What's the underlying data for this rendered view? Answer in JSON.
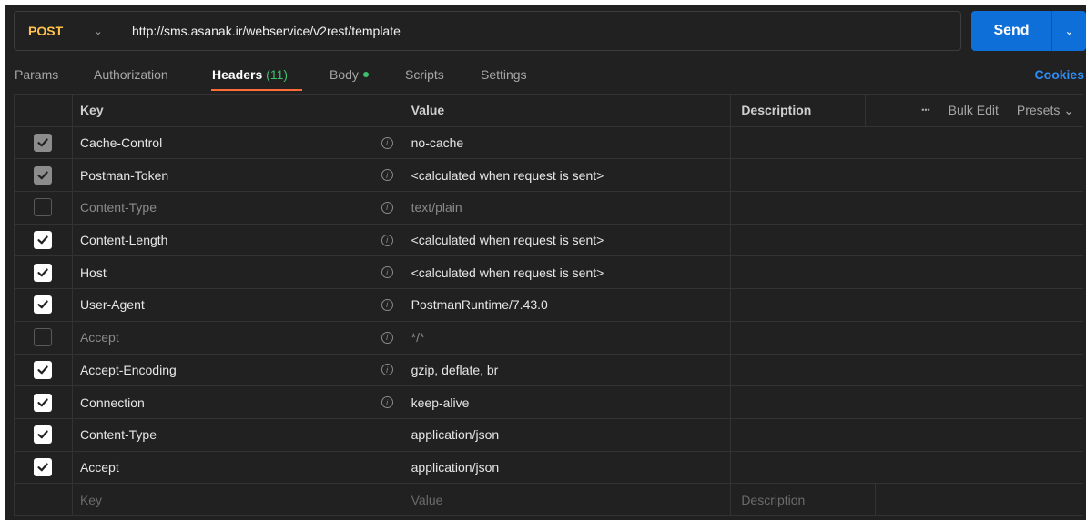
{
  "request": {
    "method": "POST",
    "url": "http://sms.asanak.ir/webservice/v2rest/template",
    "send_label": "Send"
  },
  "tabs": {
    "params": "Params",
    "authorization": "Authorization",
    "headers": "Headers",
    "headers_count": "(11)",
    "body": "Body",
    "scripts": "Scripts",
    "settings": "Settings",
    "cookies": "Cookies"
  },
  "table": {
    "col_key": "Key",
    "col_value": "Value",
    "col_description": "Description",
    "more": "•••",
    "bulk_edit": "Bulk Edit",
    "presets": "Presets ⌄",
    "rows": [
      {
        "key": "Cache-Control",
        "value": "no-cache",
        "state": "locked",
        "info": true
      },
      {
        "key": "Postman-Token",
        "value": "<calculated when request is sent>",
        "state": "locked",
        "info": true
      },
      {
        "key": "Content-Type",
        "value": "text/plain",
        "state": "off",
        "info": true
      },
      {
        "key": "Content-Length",
        "value": "<calculated when request is sent>",
        "state": "on",
        "info": true
      },
      {
        "key": "Host",
        "value": "<calculated when request is sent>",
        "state": "on",
        "info": true
      },
      {
        "key": "User-Agent",
        "value": "PostmanRuntime/7.43.0",
        "state": "on",
        "info": true
      },
      {
        "key": "Accept",
        "value": "*/*",
        "state": "off",
        "info": true
      },
      {
        "key": "Accept-Encoding",
        "value": "gzip, deflate, br",
        "state": "on",
        "info": true
      },
      {
        "key": "Connection",
        "value": "keep-alive",
        "state": "on",
        "info": true
      },
      {
        "key": "Content-Type",
        "value": "application/json",
        "state": "on",
        "info": false
      },
      {
        "key": "Accept",
        "value": "application/json",
        "state": "on",
        "info": false
      }
    ],
    "placeholder_key": "Key",
    "placeholder_value": "Value",
    "placeholder_description": "Description"
  },
  "colors": {
    "method": "#ffc24c",
    "send": "#0e6fd8",
    "accent": "#ff6c37",
    "count": "#3fbf6b",
    "cookies": "#2c8ef8"
  }
}
